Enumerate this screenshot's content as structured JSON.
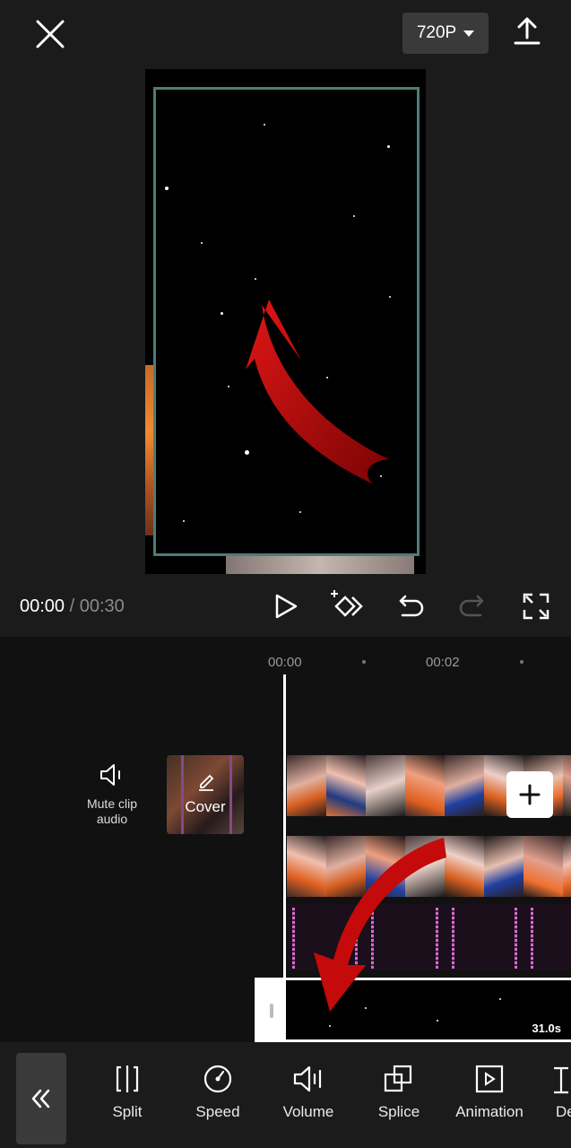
{
  "header": {
    "resolution_label": "720P"
  },
  "player": {
    "current_time": "00:00",
    "separator": " / ",
    "total_time": "00:30"
  },
  "timeline": {
    "ruler": [
      "00:00",
      "00:02"
    ],
    "mute_label": "Mute clip audio",
    "cover_label": "Cover",
    "overlay_duration": "31.0s"
  },
  "toolbar": {
    "items": [
      {
        "label": "Split",
        "icon": "split-icon"
      },
      {
        "label": "Speed",
        "icon": "speed-icon"
      },
      {
        "label": "Volume",
        "icon": "volume-icon"
      },
      {
        "label": "Splice",
        "icon": "splice-icon"
      },
      {
        "label": "Animation",
        "icon": "animation-icon"
      },
      {
        "label": "De",
        "icon": "delete-icon"
      }
    ]
  },
  "colors": {
    "accent_red": "#c40a0a",
    "frame_border": "#4d7c78",
    "audio_wave": "#d96ad0"
  }
}
